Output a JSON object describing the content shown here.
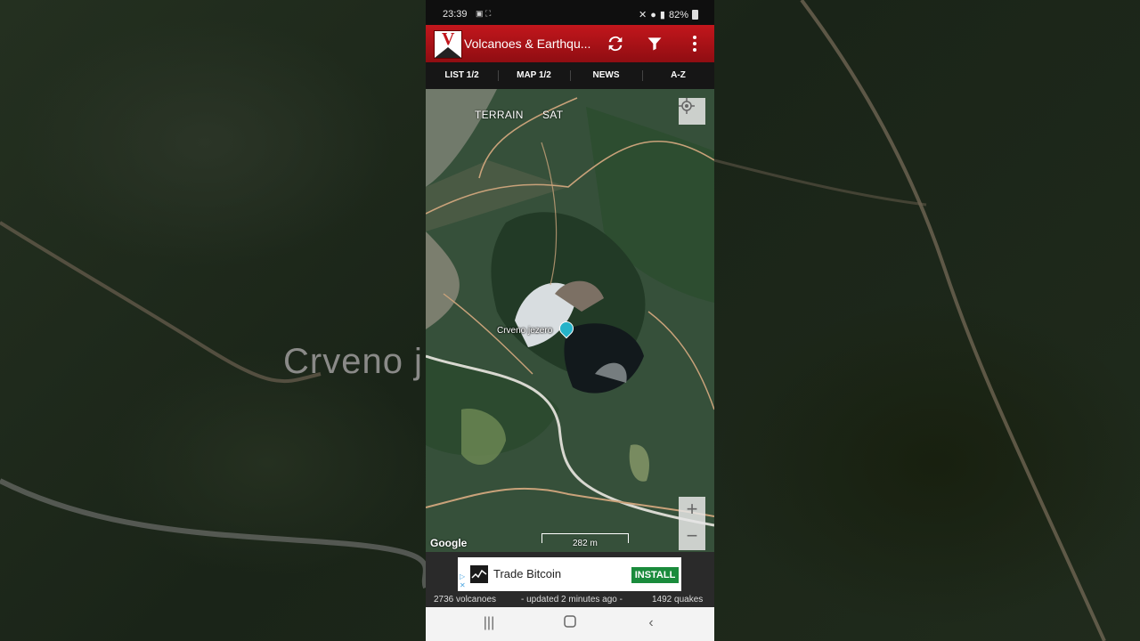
{
  "background": {
    "blurred_label": "Crveno j"
  },
  "status_bar": {
    "time": "23:39",
    "battery": "82%"
  },
  "app_bar": {
    "title": "Volcanoes & Earthqu..."
  },
  "tabs": [
    {
      "label": "LIST 1/2"
    },
    {
      "label": "MAP 1/2"
    },
    {
      "label": "NEWS"
    },
    {
      "label": "A-Z"
    }
  ],
  "map": {
    "type_terrain": "TERRAIN",
    "type_sat": "SAT",
    "place_label": "Crveno jezero",
    "attribution": "Google",
    "scale": "282 m",
    "zoom_in": "+",
    "zoom_out": "−"
  },
  "ad": {
    "text": "Trade Bitcoin",
    "button": "INSTALL"
  },
  "stats": {
    "volcanoes": "2736 volcanoes",
    "updated": "-  updated 2 minutes ago  -",
    "quakes": "1492 quakes"
  },
  "colors": {
    "app_bar": "#c2161c",
    "install": "#1a8b3c",
    "pin": "#26b3c9"
  }
}
